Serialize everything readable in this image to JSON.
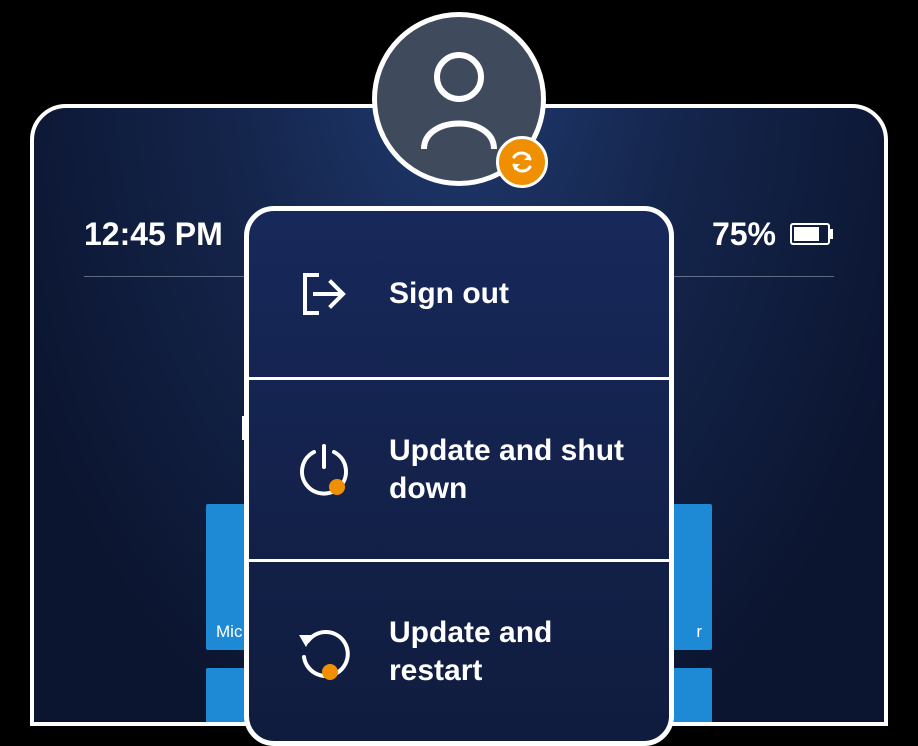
{
  "status": {
    "time": "12:45 PM",
    "battery_percent": "75%"
  },
  "tiles": {
    "left_label_partial": "Mic",
    "right_label_partial": "r"
  },
  "menu": {
    "items": [
      {
        "label": "Sign out"
      },
      {
        "label": "Update and shut down"
      },
      {
        "label": "Update and restart"
      }
    ]
  },
  "colors": {
    "accent": "#f09000",
    "tile": "#1e8ad6"
  }
}
